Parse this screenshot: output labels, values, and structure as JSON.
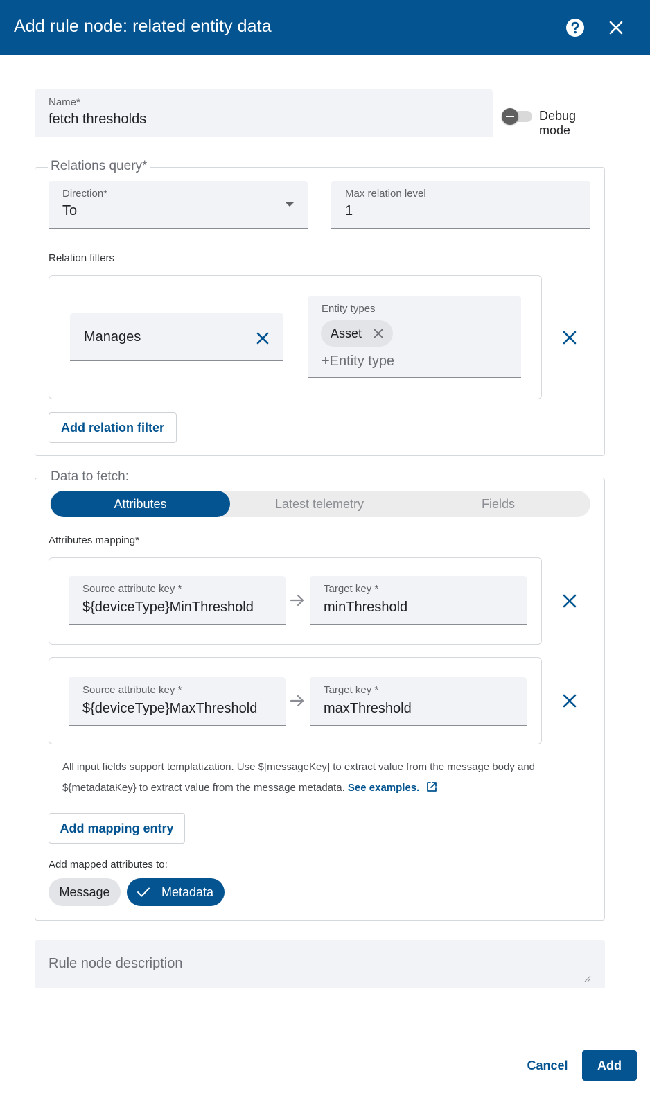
{
  "dialog": {
    "title": "Add rule node: related entity data",
    "help_icon": "help-circle-icon",
    "close_icon": "close-icon"
  },
  "name_field": {
    "label": "Name*",
    "value": "fetch thresholds"
  },
  "debug_mode": {
    "label": "Debug mode",
    "enabled": false
  },
  "relations_query": {
    "legend": "Relations query*",
    "direction": {
      "label": "Direction*",
      "value": "To"
    },
    "max_relation_level": {
      "label": "Max relation level",
      "value": "1"
    },
    "relation_filters_label": "Relation filters",
    "filters": [
      {
        "relation_type": "Manages",
        "entity_types_label": "Entity types",
        "entity_types": [
          "Asset"
        ],
        "entity_type_placeholder": "+Entity type"
      }
    ],
    "add_filter_label": "Add relation filter"
  },
  "data_to_fetch": {
    "legend": "Data to fetch:",
    "tabs": [
      "Attributes",
      "Latest telemetry",
      "Fields"
    ],
    "active_tab": "Attributes",
    "mapping_label": "Attributes mapping*",
    "mappings": [
      {
        "source_label": "Source attribute key",
        "source_value": "${deviceType}MinThreshold",
        "target_label": "Target key",
        "target_value": "minThreshold"
      },
      {
        "source_label": "Source attribute key",
        "source_value": "${deviceType}MaxThreshold",
        "target_label": "Target key",
        "target_value": "maxThreshold"
      }
    ],
    "hint_text": "All input fields support templatization. Use $[messageKey] to extract value from the message body and ${metadataKey} to extract value from the message metadata.",
    "hint_link": "See examples.",
    "add_mapping_label": "Add mapping entry",
    "add_to_label": "Add mapped attributes to:",
    "add_to_options": [
      "Message",
      "Metadata"
    ],
    "add_to_selected": "Metadata"
  },
  "description": {
    "placeholder": "Rule node description"
  },
  "footer": {
    "cancel_label": "Cancel",
    "add_label": "Add"
  },
  "colors": {
    "primary": "#035490",
    "field_bg": "#f2f3f6"
  }
}
